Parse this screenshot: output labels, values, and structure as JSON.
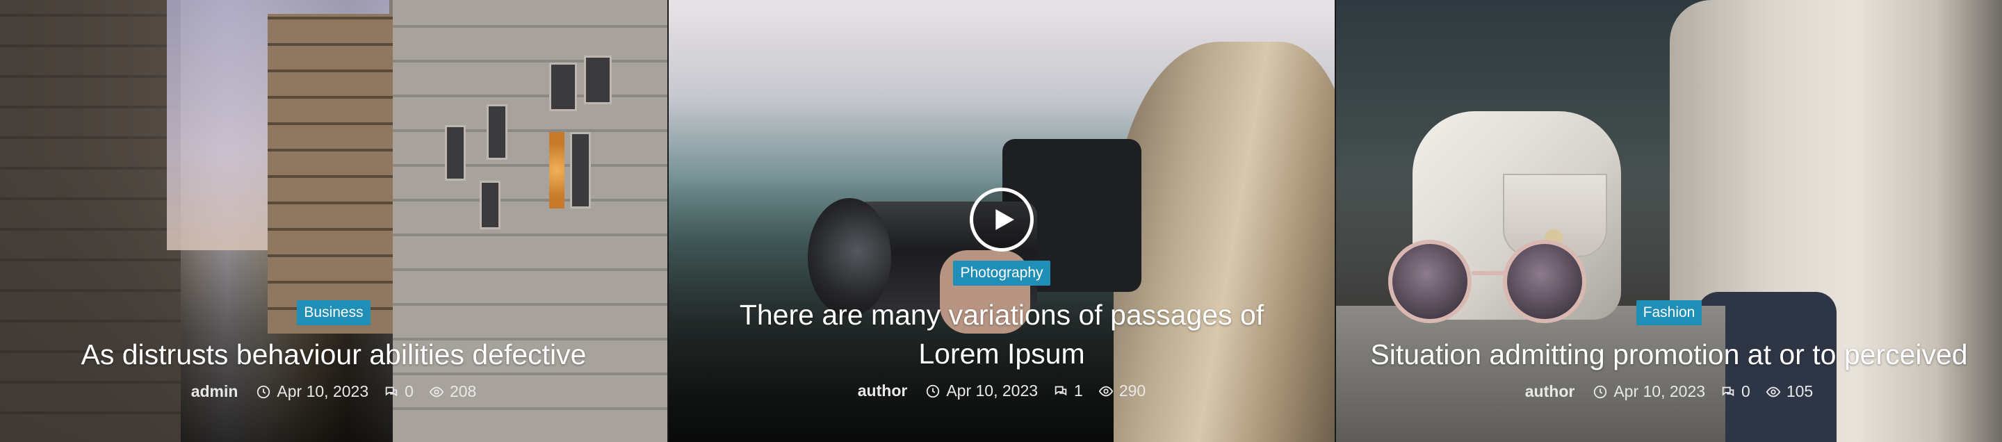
{
  "posts": [
    {
      "category": "Business",
      "title": "As distrusts behaviour abilities defective",
      "author": "admin",
      "date": "Apr 10, 2023",
      "comments": "0",
      "views": "208",
      "has_video": false
    },
    {
      "category": "Photography",
      "title": "There are many variations of passages of Lorem Ipsum",
      "author": "author",
      "date": "Apr 10, 2023",
      "comments": "1",
      "views": "290",
      "has_video": true
    },
    {
      "category": "Fashion",
      "title": "Situation admitting promotion at or to perceived",
      "author": "author",
      "date": "Apr 10, 2023",
      "comments": "0",
      "views": "105",
      "has_video": false
    }
  ],
  "icons": {
    "date": "clock-icon",
    "comments": "comments-icon",
    "views": "eye-icon",
    "video": "play-icon"
  },
  "colors": {
    "badge": "#1f8fb8",
    "text": "#ffffff"
  }
}
